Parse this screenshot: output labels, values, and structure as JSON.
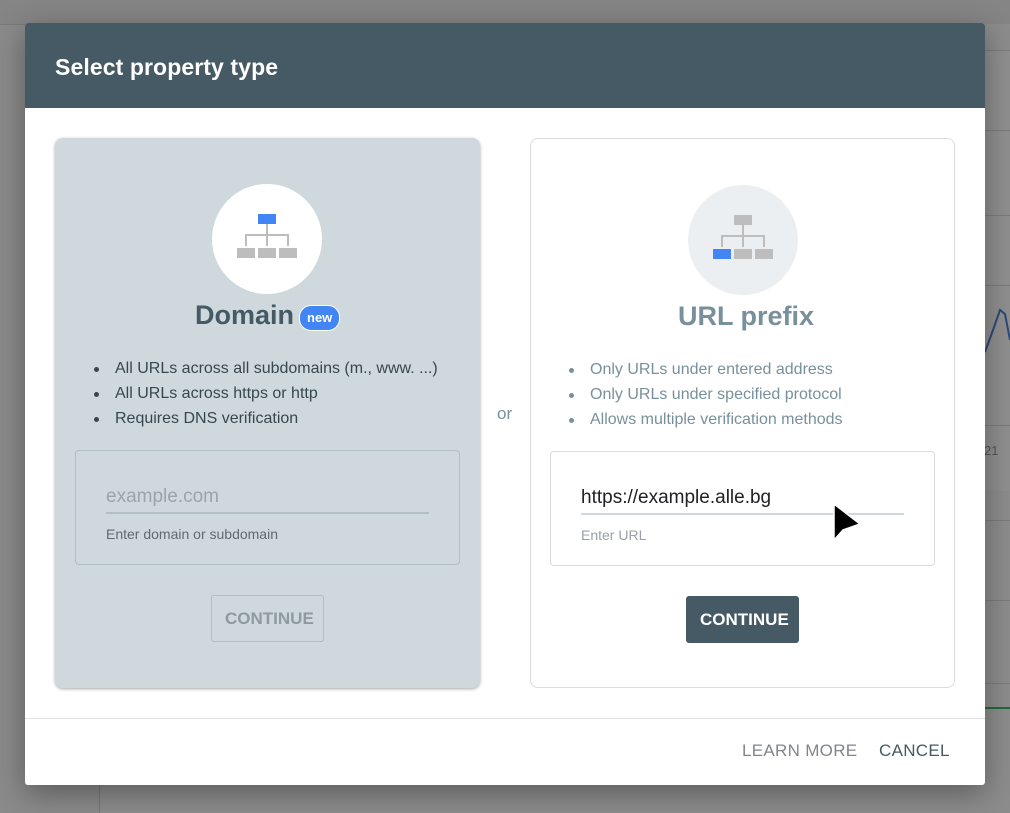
{
  "dialog": {
    "title": "Select property type",
    "or_label": "or"
  },
  "domain_card": {
    "title": "Domain",
    "badge": "new",
    "bullets": [
      "All URLs across all subdomains (m., www. ...)",
      "All URLs across https or http",
      "Requires DNS verification"
    ],
    "input_placeholder": "example.com",
    "input_value": "",
    "input_helper": "Enter domain or subdomain",
    "continue_label": "CONTINUE",
    "icon": "sitemap-icon",
    "icon_highlight_color": "#4285f4"
  },
  "url_card": {
    "title": "URL prefix",
    "bullets": [
      "Only URLs under entered address",
      "Only URLs under specified protocol",
      "Allows multiple verification methods"
    ],
    "input_value": "https://example.alle.bg",
    "input_helper": "Enter URL",
    "continue_label": "CONTINUE",
    "icon": "sitemap-icon",
    "icon_highlight_color": "#4285f4"
  },
  "footer": {
    "learn_more_label": "LEARN MORE",
    "cancel_label": "CANCEL"
  },
  "background": {
    "tick_label": "21"
  },
  "colors": {
    "header_bg": "#455a64",
    "domain_card_bg": "#cfd8dc",
    "primary_button_bg": "#455a64",
    "badge_bg": "#4285f4"
  }
}
